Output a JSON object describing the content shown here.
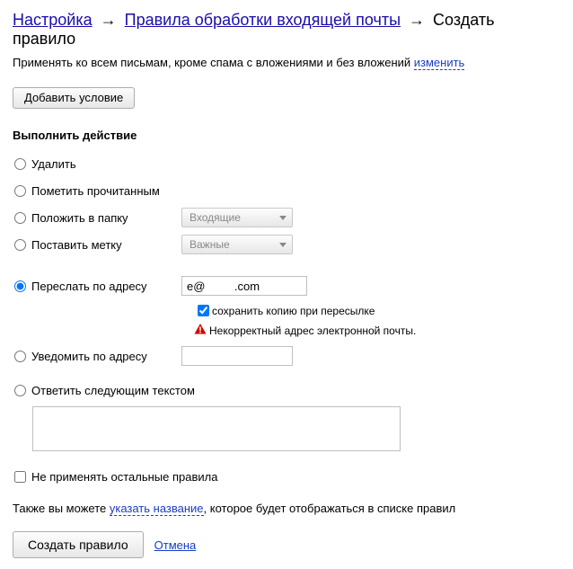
{
  "breadcrumb": {
    "settings": "Настройка",
    "rules": "Правила обработки входящей почты",
    "current": "Создать правило"
  },
  "subline": {
    "prefix": "Применять ко всем письмам, кроме спама с вложениями и без вложений ",
    "change": "изменить"
  },
  "add_condition": "Добавить условие",
  "action_title": "Выполнить действие",
  "options": {
    "delete": "Удалить",
    "mark_read": "Пометить прочитанным",
    "move_folder": "Положить в папку",
    "set_label": "Поставить метку",
    "forward": "Переслать по адресу",
    "notify": "Уведомить по адресу",
    "reply": "Ответить следующим текстом"
  },
  "selects": {
    "inbox": "Входящие",
    "important": "Важные"
  },
  "forward": {
    "value": "e@         .com",
    "keep_copy": "сохранить копию при пересылке",
    "error": "Некорректный адрес электронной почты."
  },
  "notify_value": "",
  "reply_value": "",
  "no_other_rules": "Не применять остальные правила",
  "bottom": {
    "prefix": "Также вы можете ",
    "link": "указать название",
    "suffix": ", которое будет отображаться в списке правил"
  },
  "actions": {
    "create": "Создать правило",
    "cancel": "Отмена"
  }
}
